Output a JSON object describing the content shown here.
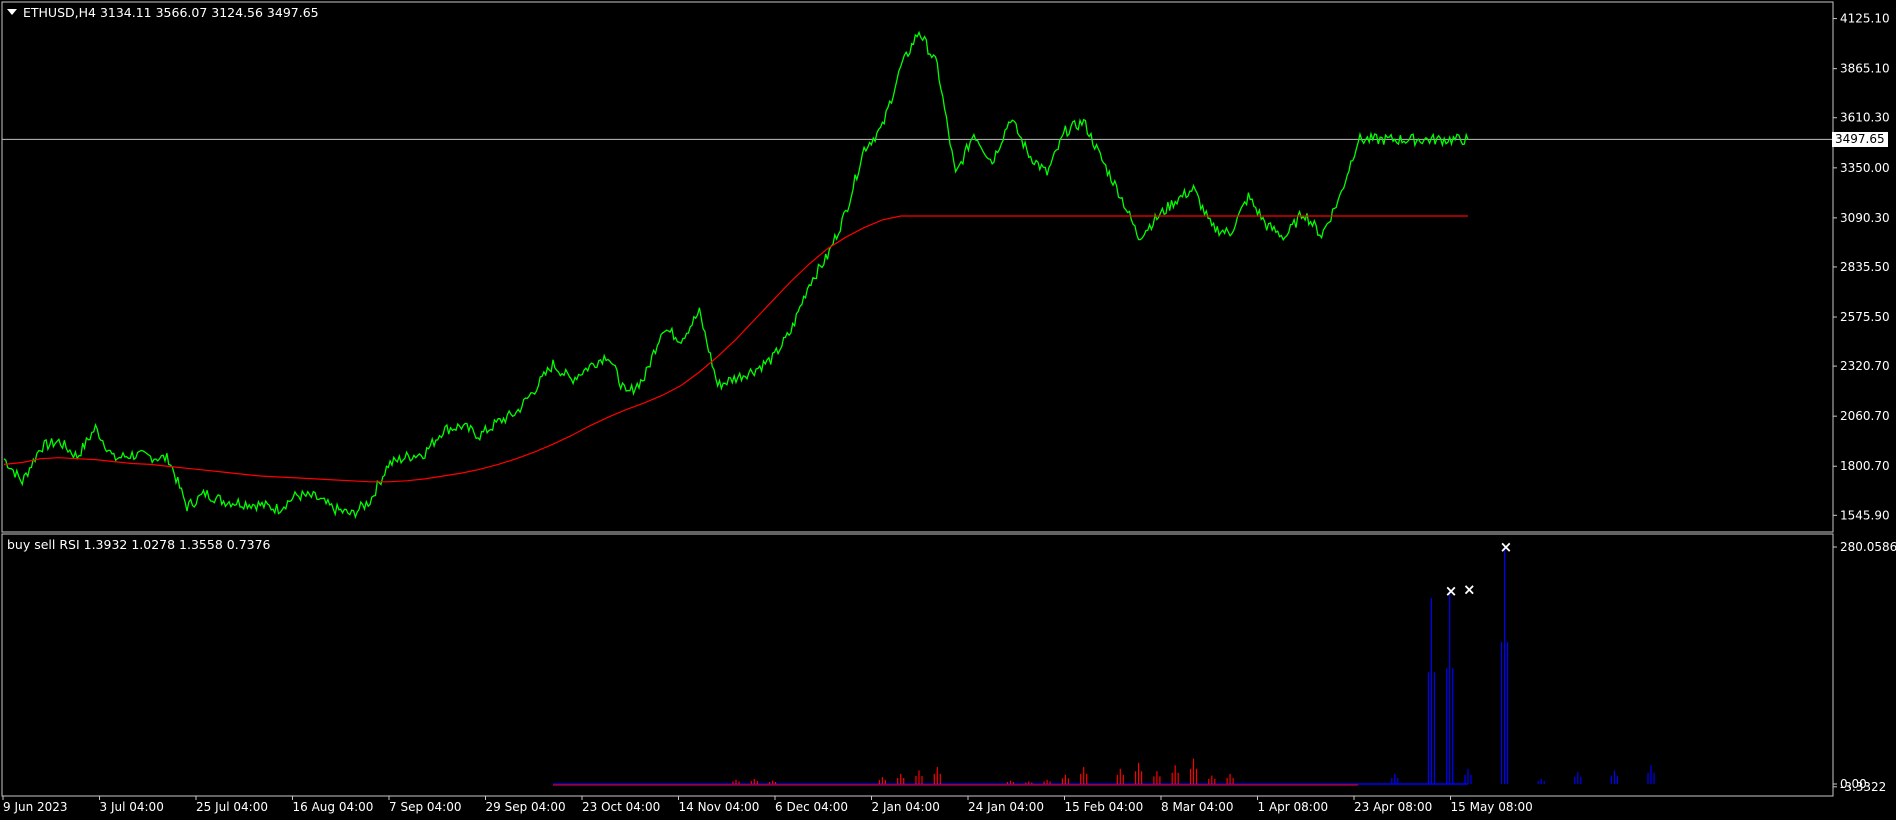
{
  "header": {
    "symbol_line": "ETHUSD,H4  3134.11 3566.07 3124.56 3497.65",
    "indicator_line": "buy sell RSI 1.3932 1.0278 1.3558 0.7376"
  },
  "colors": {
    "background": "#000000",
    "price": "#00ff00",
    "ma": "#ff0000",
    "rsi_red": "#ff0000",
    "rsi_blue": "#0000ff",
    "grid_line": "#c0c0c0",
    "text": "#ffffff"
  },
  "chart_data": [
    {
      "type": "line",
      "title": "ETHUSD,H4",
      "ylim": [
        1480,
        4180
      ],
      "y_ticks": [
        "4125.10",
        "3865.10",
        "3610.30",
        "3350.00",
        "3090.30",
        "2835.50",
        "2575.50",
        "2320.70",
        "2060.70",
        "1800.70",
        "1545.90"
      ],
      "x_ticks": [
        "9 Jun 2023",
        "3 Jul 04:00",
        "25 Jul 04:00",
        "16 Aug 04:00",
        "7 Sep 04:00",
        "29 Sep 04:00",
        "23 Oct 04:00",
        "14 Nov 04:00",
        "6 Dec 04:00",
        "2 Jan 04:00",
        "24 Jan 04:00",
        "15 Feb 04:00",
        "8 Mar 04:00",
        "1 Apr 08:00",
        "23 Apr 08:00",
        "15 May 08:00"
      ],
      "current_price": "3497.65",
      "series": [
        {
          "name": "ETHUSD",
          "x": [
            0,
            5,
            10,
            15,
            20,
            25,
            30,
            35,
            40,
            45,
            50,
            55,
            60,
            65,
            70,
            75,
            80,
            85,
            90,
            95,
            100,
            105,
            110,
            115,
            120,
            125,
            130,
            135,
            140,
            145,
            150,
            155,
            160,
            165,
            170,
            175,
            180,
            185,
            190,
            195,
            200,
            205,
            210,
            215,
            220,
            225,
            230,
            235,
            240,
            245,
            250,
            255,
            260,
            265,
            270,
            275,
            280,
            285,
            290,
            295,
            300,
            305,
            310,
            315,
            320,
            325,
            330,
            335,
            340,
            345,
            350,
            355,
            360,
            365,
            370,
            375,
            380,
            385,
            390,
            395,
            400
          ],
          "values": [
            1840,
            1720,
            1900,
            1930,
            1850,
            2000,
            1840,
            1860,
            1850,
            1840,
            1590,
            1660,
            1620,
            1610,
            1600,
            1580,
            1650,
            1640,
            1580,
            1550,
            1620,
            1810,
            1850,
            1870,
            1990,
            2010,
            1960,
            2030,
            2080,
            2200,
            2330,
            2250,
            2320,
            2380,
            2170,
            2260,
            2520,
            2460,
            2600,
            2220,
            2260,
            2300,
            2360,
            2500,
            2750,
            2890,
            3120,
            3450,
            3560,
            3870,
            4060,
            3880,
            3310,
            3530,
            3380,
            3610,
            3420,
            3320,
            3540,
            3590,
            3390,
            3210,
            2990,
            3090,
            3180,
            3240,
            3040,
            3010,
            3200,
            3050,
            2990,
            3120,
            3000,
            3200,
            3497,
            3497,
            3497,
            3497,
            3497,
            3497,
            3497
          ]
        },
        {
          "name": "MA",
          "values": [
            1810,
            1820,
            1840,
            1845,
            1840,
            1835,
            1825,
            1815,
            1810,
            1800,
            1790,
            1780,
            1770,
            1760,
            1750,
            1745,
            1740,
            1735,
            1730,
            1725,
            1720,
            1720,
            1725,
            1735,
            1750,
            1765,
            1785,
            1810,
            1840,
            1875,
            1915,
            1960,
            2010,
            2055,
            2095,
            2130,
            2170,
            2220,
            2290,
            2370,
            2460,
            2560,
            2660,
            2760,
            2850,
            2930,
            2990,
            3040,
            3080,
            3100,
            3100,
            3100,
            3100,
            3100,
            3100,
            3100,
            3100,
            3100,
            3100,
            3100,
            3100,
            3100,
            3100,
            3100,
            3100,
            3100,
            3100,
            3100,
            3100,
            3100,
            3100,
            3100,
            3100,
            3100,
            3100,
            3100,
            3100,
            3100,
            3100,
            3100,
            3100
          ]
        }
      ]
    },
    {
      "type": "bar",
      "title": "buy sell RSI",
      "ylim": [
        -0.0035,
        280.0586
      ],
      "y_ticks": [
        "280.0586",
        "0.00",
        "-3.3322"
      ],
      "series": [
        {
          "name": "red",
          "x": [
            40,
            41,
            42,
            48,
            49,
            50,
            51,
            55,
            56,
            57,
            58,
            59,
            61,
            62,
            63,
            64,
            65,
            66,
            67
          ],
          "values": [
            5,
            6,
            4,
            8,
            12,
            16,
            20,
            4,
            3,
            5,
            11,
            20,
            18,
            25,
            15,
            22,
            30,
            10,
            12
          ]
        },
        {
          "name": "blue",
          "x": [
            76,
            78,
            79,
            80,
            82,
            84,
            86,
            88,
            90
          ],
          "values": [
            12,
            220,
            228,
            18,
            280,
            6,
            14,
            16,
            22
          ]
        }
      ],
      "markers": [
        {
          "x": 79,
          "value": 228,
          "label": "×"
        },
        {
          "x": 80,
          "value": 230,
          "label": "×"
        },
        {
          "x": 82,
          "value": 280,
          "label": "×"
        }
      ]
    }
  ]
}
